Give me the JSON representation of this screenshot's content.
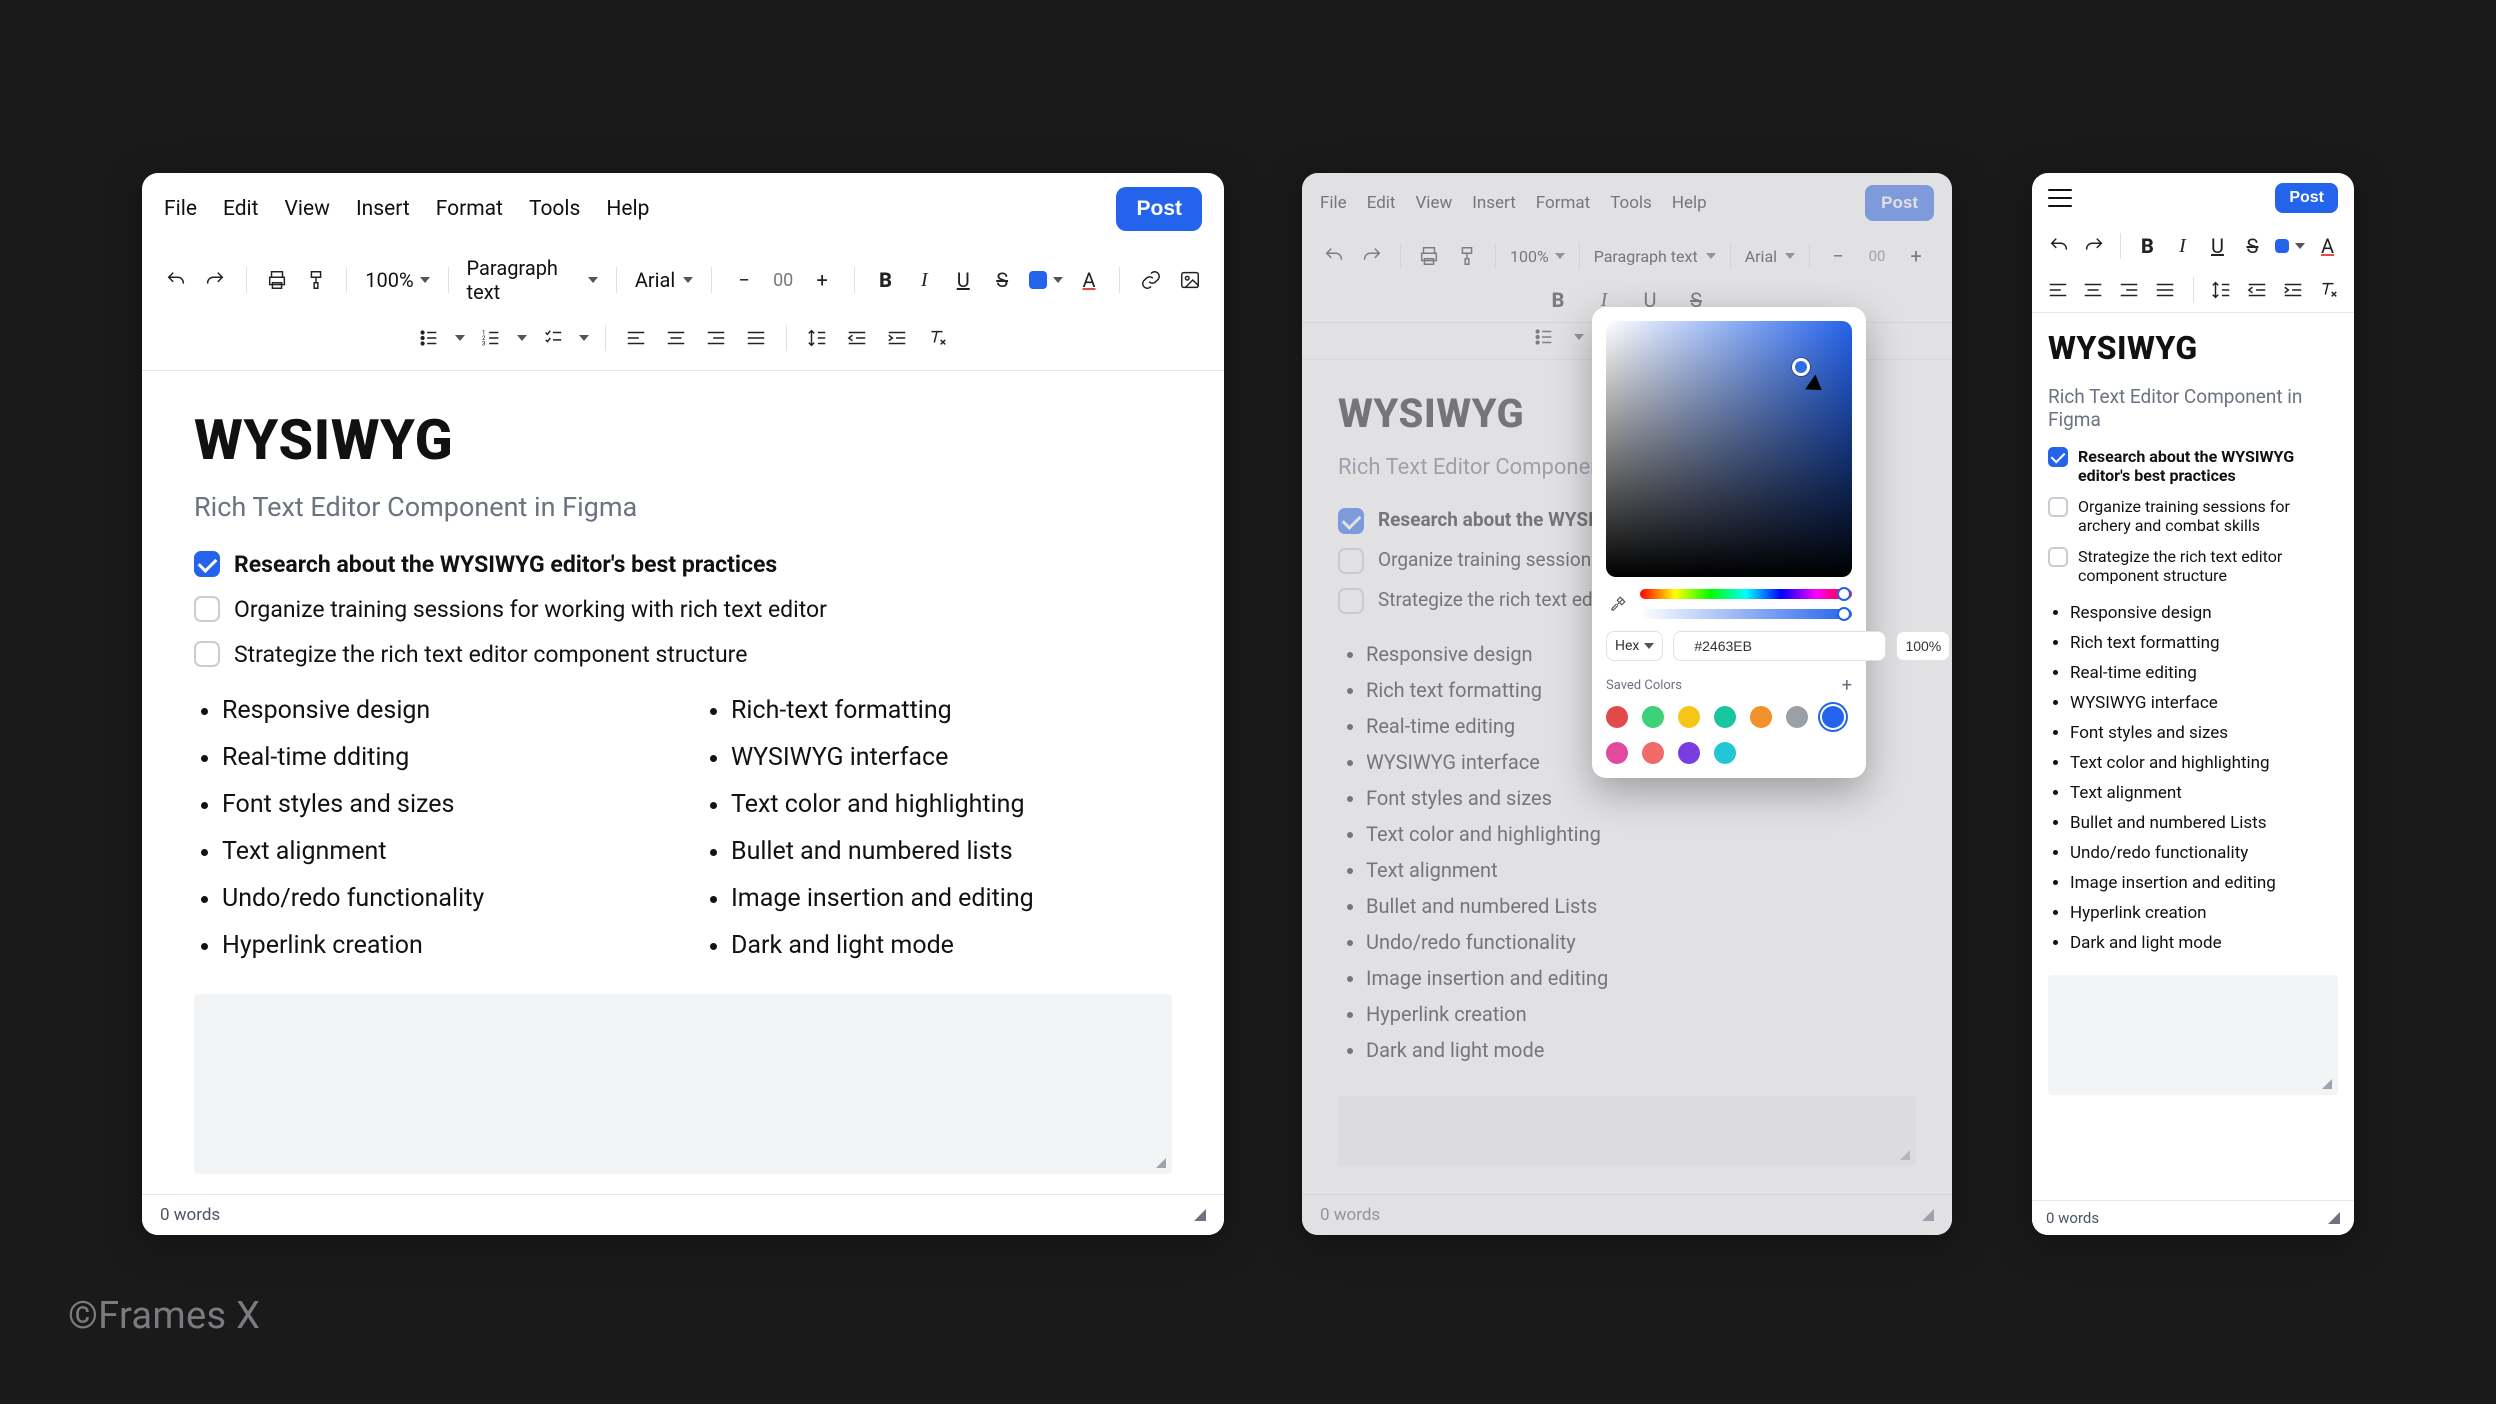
{
  "copyright": "©Frames X",
  "menus": {
    "file": "File",
    "edit": "Edit",
    "view": "View",
    "insert": "Insert",
    "format": "Format",
    "tools": "Tools",
    "help": "Help"
  },
  "post_label": "Post",
  "toolbar": {
    "zoom": "100%",
    "paragraph": "Paragraph text",
    "font": "Arial",
    "font_size_placeholder": "00"
  },
  "doc": {
    "title": "WYSIWYG",
    "subtitle": "Rich Text Editor Component in Figma",
    "checklist": [
      {
        "checked": true,
        "bold": true,
        "label": "Research about the WYSIWYG editor's best practices"
      },
      {
        "checked": false,
        "bold": false,
        "label": "Organize training sessions for working with rich text editor"
      },
      {
        "checked": false,
        "bold": false,
        "label": "Strategize the rich text editor component structure"
      }
    ],
    "bullets_left": [
      "Responsive design",
      "Real-time dditing",
      "Font styles and sizes",
      "Text alignment",
      "Undo/redo functionality",
      "Hyperlink creation"
    ],
    "bullets_right": [
      "Rich-text formatting",
      "WYSIWYG interface",
      "Text color and highlighting",
      "Bullet and numbered lists",
      "Image insertion and editing",
      "Dark and light mode"
    ]
  },
  "doc_md": {
    "subtitle_visible": "Rich Text Editor Component in",
    "checklist": [
      {
        "checked": true,
        "bold": true,
        "label": "Research about the WYSIW"
      },
      {
        "checked": false,
        "bold": false,
        "label": "Organize training sessions f"
      },
      {
        "checked": false,
        "bold": false,
        "label": "Strategize the rich text edito"
      }
    ],
    "bullets": [
      "Responsive design",
      "Rich text formatting",
      "Real-time editing",
      "WYSIWYG interface",
      "Font styles and sizes",
      "Text color and highlighting",
      "Text alignment",
      "Bullet and numbered Lists",
      "Undo/redo functionality",
      "Image insertion and editing",
      "Hyperlink creation",
      "Dark and light mode"
    ]
  },
  "doc_sm": {
    "checklist": [
      {
        "checked": true,
        "bold": true,
        "label": "Research about the WYSIWYG editor's best practices"
      },
      {
        "checked": false,
        "bold": false,
        "label": "Organize training sessions for archery and combat skills"
      },
      {
        "checked": false,
        "bold": false,
        "label": "Strategize the rich text editor component structure"
      }
    ],
    "bullets": [
      "Responsive design",
      "Rich text formatting",
      "Real-time editing",
      "WYSIWYG interface",
      "Font styles and sizes",
      "Text color and highlighting",
      "Text alignment",
      "Bullet and numbered Lists",
      "Undo/redo functionality",
      "Image insertion and editing",
      "Hyperlink creation",
      "Dark and light mode"
    ]
  },
  "status": {
    "words": "0 words"
  },
  "color_picker": {
    "mode": "Hex",
    "hex_prefix": "#",
    "hex": "2463EB",
    "opacity": "100%",
    "saved_label": "Saved Colors",
    "swatches": [
      "#E24A4A",
      "#3DD17A",
      "#F5C518",
      "#18C6A0",
      "#F2902A",
      "#9AA0A6",
      "#2463EB",
      "#E24A9E",
      "#F06A6A",
      "#7A3DE2",
      "#22C6D6"
    ],
    "selected_swatch_index": 6
  }
}
